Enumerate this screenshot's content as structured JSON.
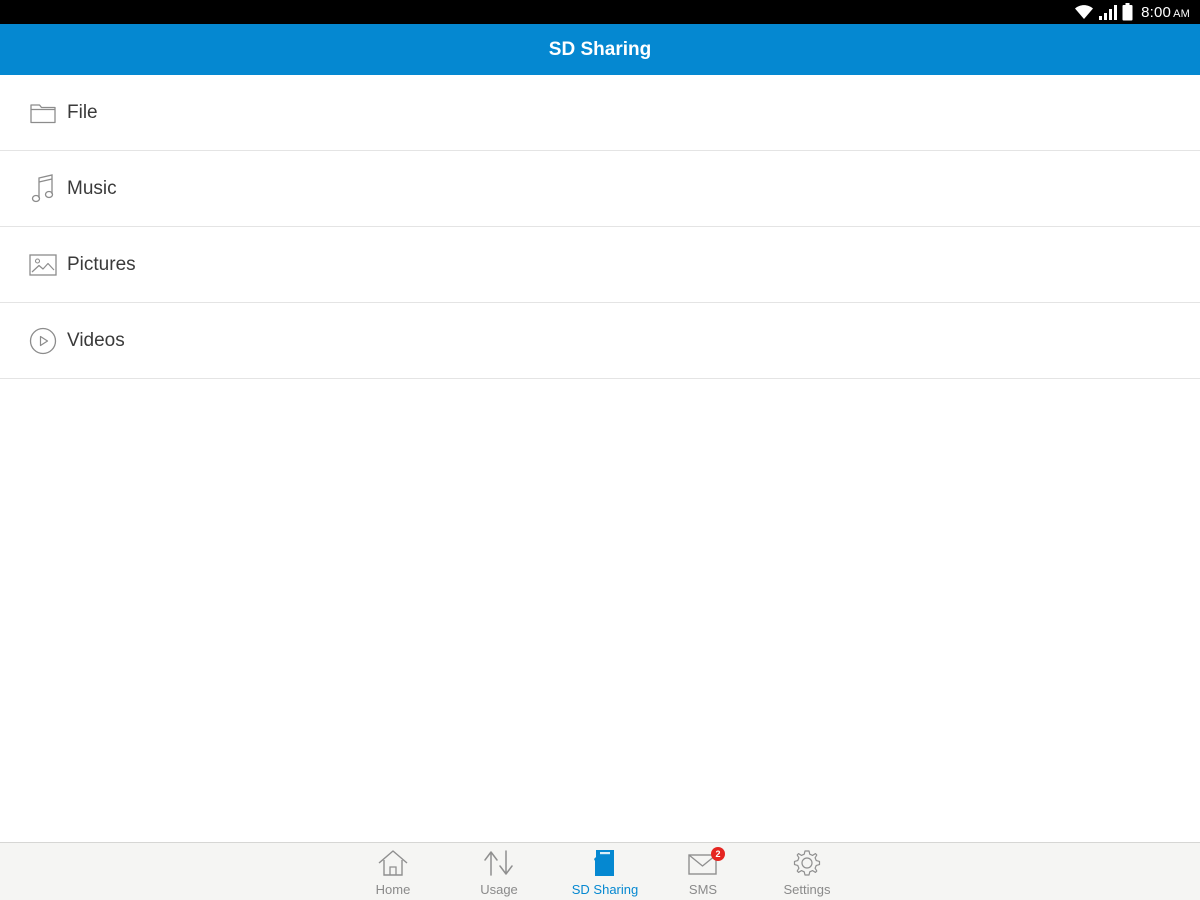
{
  "status_bar": {
    "time": "8:00",
    "ampm": "AM",
    "icons": [
      "wifi-icon",
      "signal-icon",
      "battery-icon"
    ]
  },
  "app_bar": {
    "title": "SD Sharing"
  },
  "list": {
    "items": [
      {
        "label": "File",
        "icon": "folder-icon"
      },
      {
        "label": "Music",
        "icon": "music-note-icon"
      },
      {
        "label": "Pictures",
        "icon": "picture-icon"
      },
      {
        "label": "Videos",
        "icon": "play-circle-icon"
      }
    ]
  },
  "bottom_nav": {
    "items": [
      {
        "label": "Home",
        "icon": "home-icon"
      },
      {
        "label": "Usage",
        "icon": "up-down-arrows-icon"
      },
      {
        "label": "SD Sharing",
        "icon": "sd-card-icon",
        "active": true
      },
      {
        "label": "SMS",
        "icon": "envelope-icon",
        "badge": "2"
      },
      {
        "label": "Settings",
        "icon": "gear-icon"
      }
    ]
  },
  "colors": {
    "primary": "#0588d1",
    "badge": "#e52521",
    "inactive_label": "#8a8a8a"
  }
}
